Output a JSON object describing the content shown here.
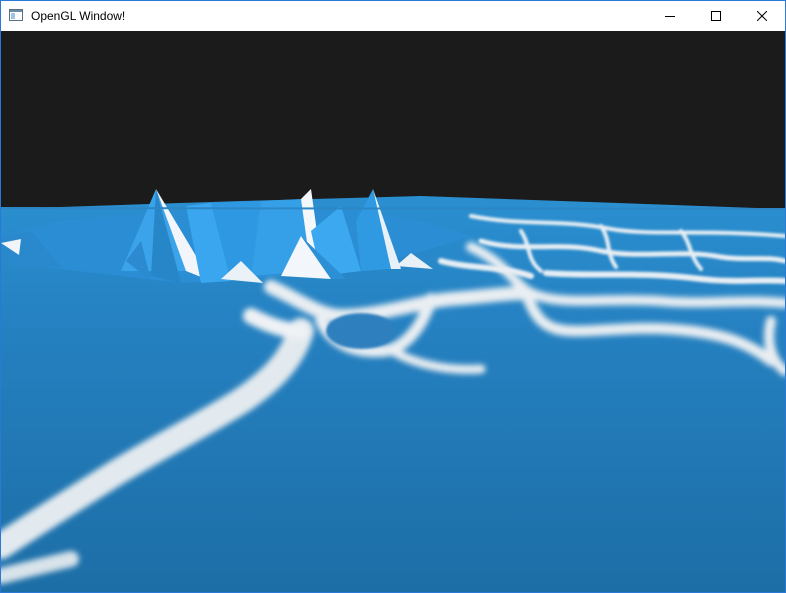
{
  "window": {
    "title": "OpenGL Window!",
    "accent_color": "#2b79d6"
  },
  "titlebar": {
    "icons": {
      "app": "window-app-icon",
      "minimize": "minimize-icon",
      "maximize": "maximize-icon",
      "close": "close-icon"
    }
  },
  "scene": {
    "description_colors": {
      "sky": "#1b1b1b",
      "water_deep": "#1f74ad",
      "water_light": "#2f9ae0",
      "foam": "#e9eef2"
    }
  }
}
